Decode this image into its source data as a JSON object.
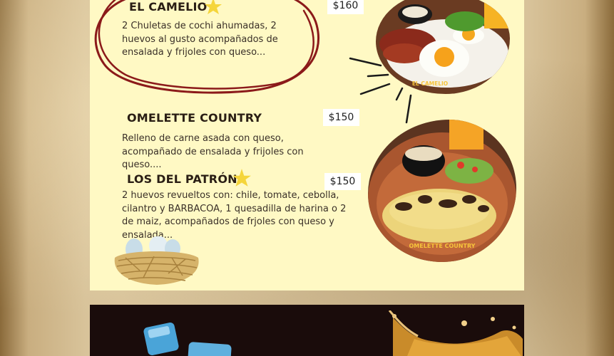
{
  "menu": {
    "items": [
      {
        "title": "EL CAMELIO",
        "price": "$160",
        "description": "2 Chuletas de cochi ahumadas, 2 huevos al gusto acompañados de ensalada y frijoles con queso..."
      },
      {
        "title": "OMELETTE COUNTRY",
        "price": "$150",
        "description": "Relleno de carne asada con queso, acompañado de ensalada y frijoles con queso...."
      },
      {
        "title": "LOS DEL PATRÓN",
        "price": "$150",
        "description": "2 huevos revueltos con: chile, tomate, cebolla, cilantro y BARBACOA, 1 quesadilla de harina o 2 de maiz, acompañados de frjoles con queso y ensalada..."
      }
    ],
    "photos": [
      {
        "label": "EL CAMELIO"
      },
      {
        "label": "OMELETTE COUNTRY"
      }
    ]
  },
  "colors": {
    "panel": "#fff9c4",
    "circle_stroke": "#8b1a1a",
    "star": "#f5d53a",
    "label": "#f6c43b",
    "bottom_band": "#1a0c0b"
  },
  "icons": [
    "star-icon",
    "hand-drawn-circle",
    "burst-lines",
    "egg-nest-illustration",
    "ice-cube-illustration",
    "splash-illustration"
  ]
}
